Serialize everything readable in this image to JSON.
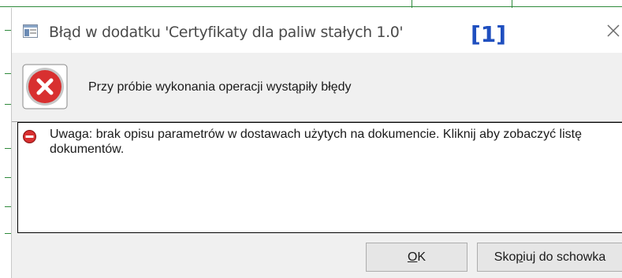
{
  "window": {
    "title": "Błąd w dodatku 'Certyfikaty dla paliw stałych 1.0'",
    "badge": "[1]",
    "close_glyph": "✕"
  },
  "header": {
    "icon": "error-icon",
    "text": "Przy próbie wykonania operacji wystąpiły błędy"
  },
  "messages": [
    {
      "icon": "error-icon",
      "text": "Uwaga: brak opisu parametrów w dostawach użytych na dokumencie. Kliknij aby zobaczyć listę dokumentów."
    }
  ],
  "buttons": {
    "ok_mnemonic": "O",
    "ok_rest": "K",
    "copy_pre": "Sko",
    "copy_mnemonic": "p",
    "copy_post": "iuj do schowka"
  },
  "colors": {
    "badge": "#1f4fbf",
    "error_red": "#d83030"
  }
}
